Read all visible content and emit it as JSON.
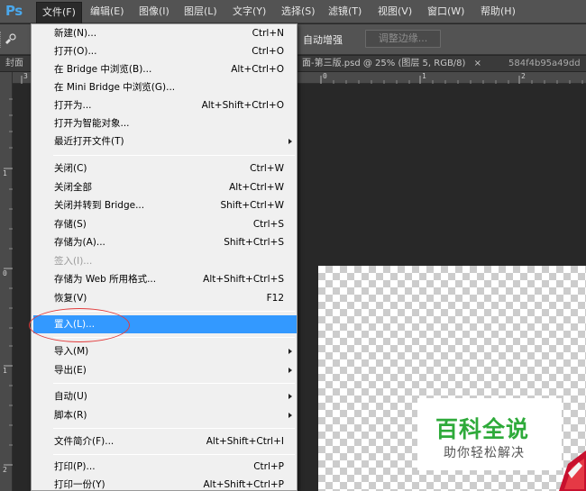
{
  "app": {
    "logo": "Ps"
  },
  "menubar": {
    "items": [
      {
        "label": "文件(F)",
        "active": true
      },
      {
        "label": "编辑(E)"
      },
      {
        "label": "图像(I)"
      },
      {
        "label": "图层(L)"
      },
      {
        "label": "文字(Y)"
      },
      {
        "label": "选择(S)"
      },
      {
        "label": "滤镜(T)"
      },
      {
        "label": "视图(V)"
      },
      {
        "label": "窗口(W)"
      },
      {
        "label": "帮助(H)"
      }
    ]
  },
  "options": {
    "auto_enhance": "自动增强",
    "refine_edge": "调整边缘..."
  },
  "tabs": {
    "left": "封面",
    "current": "面-第三版.psd @ 25% (图层 5, RGB/8)",
    "close": "×",
    "other": "584f4b95a49dd"
  },
  "ruler": {
    "top_labels": [
      "3",
      "0",
      "1",
      "2"
    ],
    "left_labels": [
      "1",
      "0",
      "1",
      "2"
    ]
  },
  "file_menu": {
    "items": [
      {
        "label": "新建(N)...",
        "shortcut": "Ctrl+N"
      },
      {
        "label": "打开(O)...",
        "shortcut": "Ctrl+O"
      },
      {
        "label": "在 Bridge 中浏览(B)...",
        "shortcut": "Alt+Ctrl+O"
      },
      {
        "label": "在 Mini Bridge 中浏览(G)...",
        "shortcut": ""
      },
      {
        "label": "打开为...",
        "shortcut": "Alt+Shift+Ctrl+O"
      },
      {
        "label": "打开为智能对象...",
        "shortcut": ""
      },
      {
        "label": "最近打开文件(T)",
        "shortcut": "",
        "submenu": true
      },
      {
        "label": "关闭(C)",
        "shortcut": "Ctrl+W"
      },
      {
        "label": "关闭全部",
        "shortcut": "Alt+Ctrl+W"
      },
      {
        "label": "关闭并转到 Bridge...",
        "shortcut": "Shift+Ctrl+W"
      },
      {
        "label": "存储(S)",
        "shortcut": "Ctrl+S"
      },
      {
        "label": "存储为(A)...",
        "shortcut": "Shift+Ctrl+S"
      },
      {
        "label": "签入(I)...",
        "shortcut": "",
        "disabled": true
      },
      {
        "label": "存储为 Web 所用格式...",
        "shortcut": "Alt+Shift+Ctrl+S"
      },
      {
        "label": "恢复(V)",
        "shortcut": "F12"
      },
      {
        "label": "置入(L)...",
        "shortcut": "",
        "highlighted": true
      },
      {
        "label": "导入(M)",
        "shortcut": "",
        "submenu": true
      },
      {
        "label": "导出(E)",
        "shortcut": "",
        "submenu": true
      },
      {
        "label": "自动(U)",
        "shortcut": "",
        "submenu": true
      },
      {
        "label": "脚本(R)",
        "shortcut": "",
        "submenu": true
      },
      {
        "label": "文件简介(F)...",
        "shortcut": "Alt+Shift+Ctrl+I"
      },
      {
        "label": "打印(P)...",
        "shortcut": "Ctrl+P"
      },
      {
        "label": "打印一份(Y)",
        "shortcut": "Alt+Shift+Ctrl+P"
      }
    ]
  },
  "watermark": {
    "title": "百科全说",
    "subtitle": "助你轻松解决"
  },
  "colors": {
    "highlight": "#3399ff",
    "annotation": "#e23c3c",
    "watermark_green": "#2eaa3a",
    "ps_blue": "#4aa8ec"
  }
}
